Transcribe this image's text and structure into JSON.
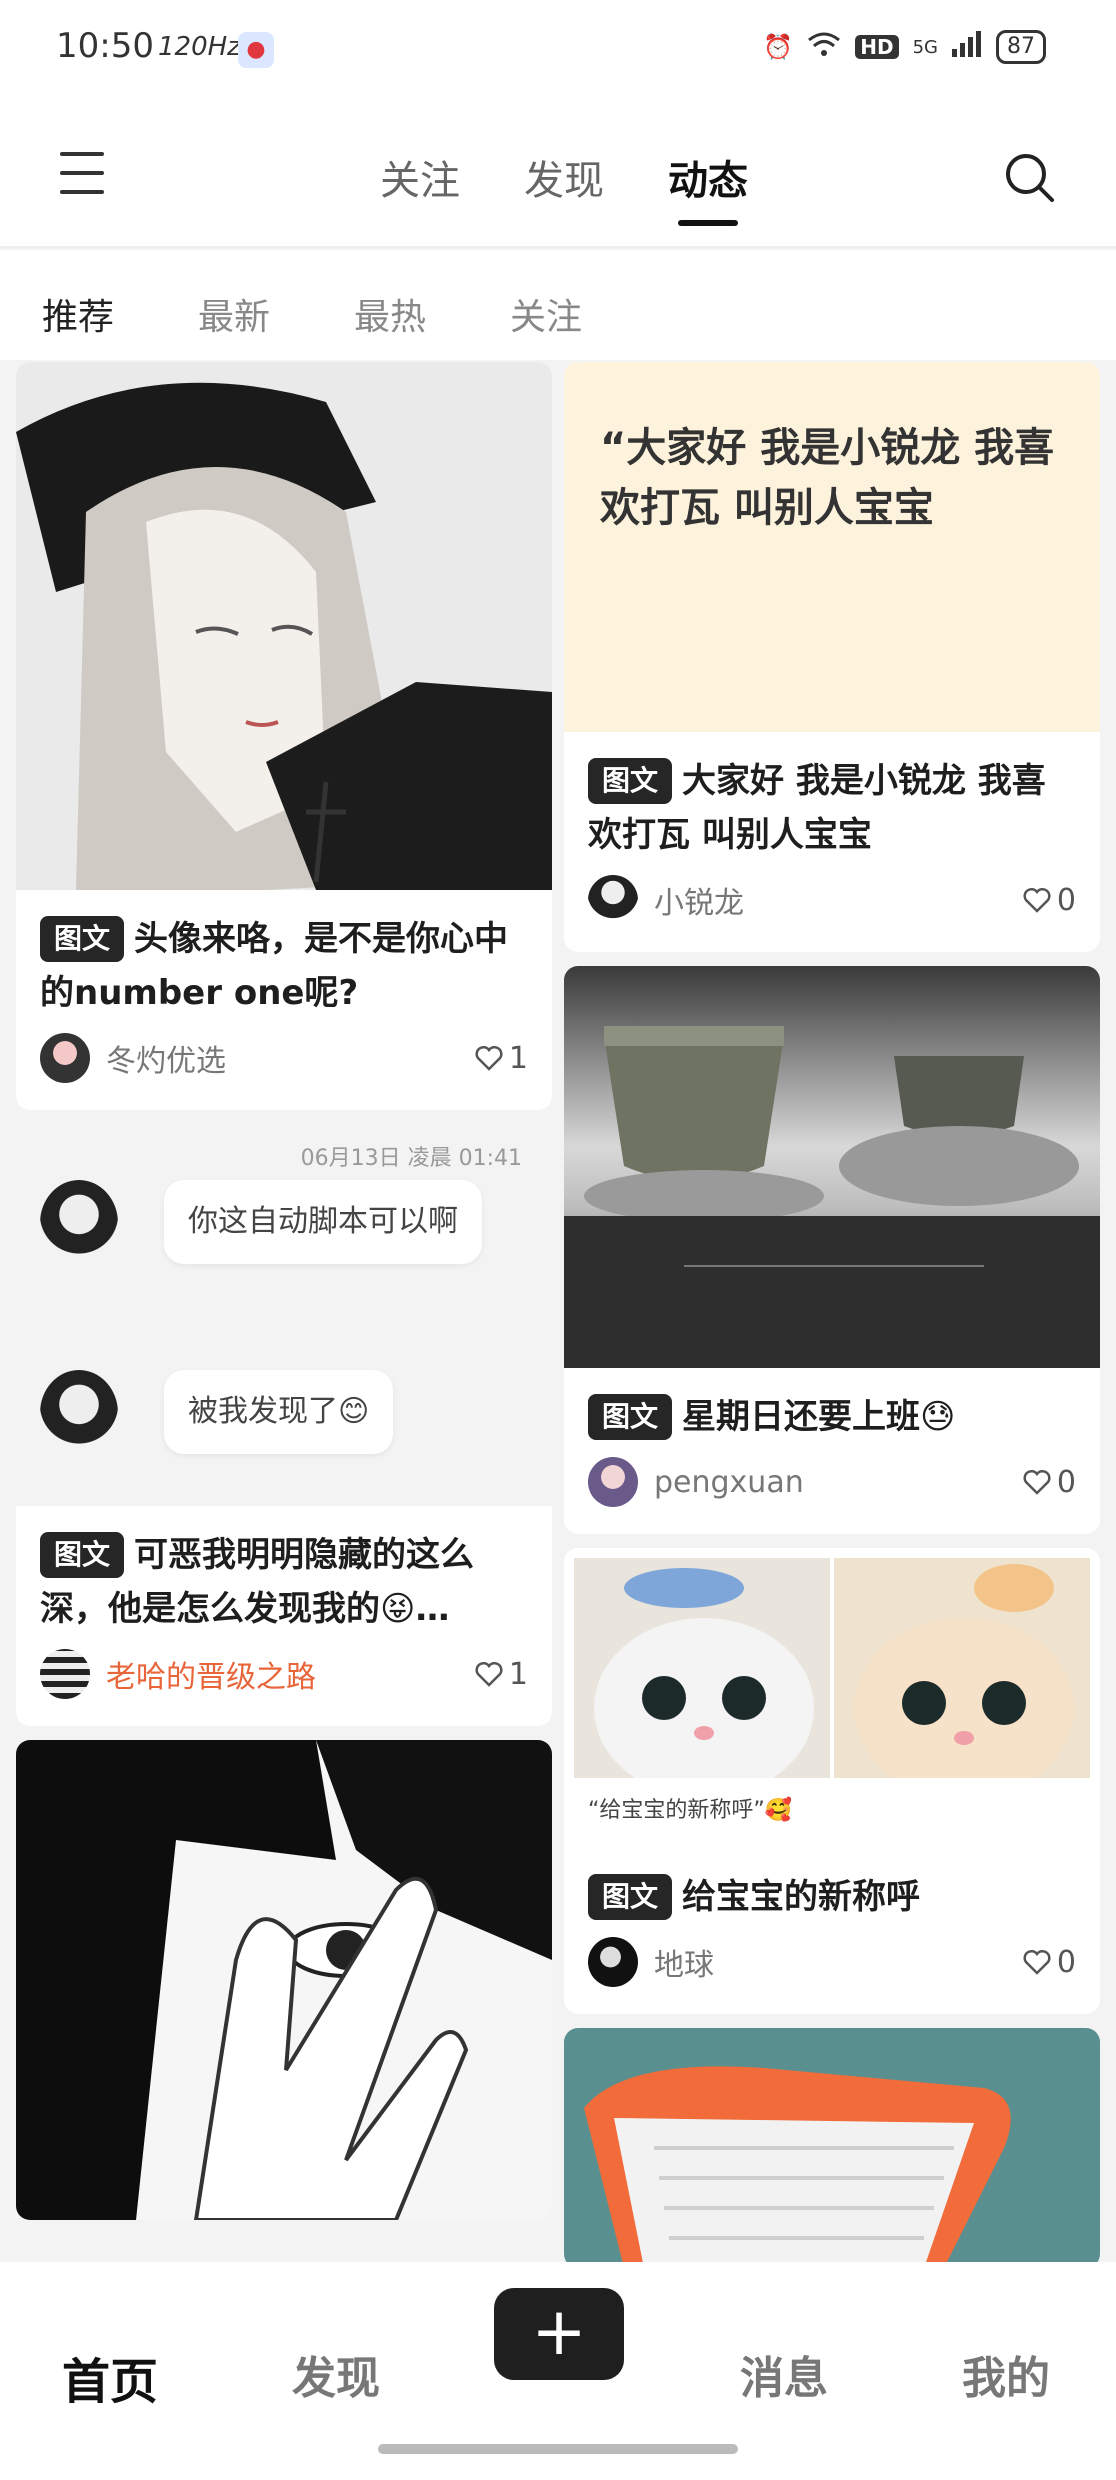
{
  "status": {
    "time": "10:50",
    "refresh": "120Hz",
    "hd": "HD",
    "network": "5G",
    "battery": "87"
  },
  "top_nav": {
    "tabs": [
      "关注",
      "发现",
      "动态"
    ],
    "active_index": 2
  },
  "sub_nav": {
    "tabs": [
      "推荐",
      "最新",
      "最热",
      "关注"
    ],
    "active_index": 0
  },
  "tag_label": "图文",
  "feed": {
    "left": [
      {
        "title": "头像来咯，是不是你心中的number one呢?",
        "author": "冬灼优选",
        "likes": "1"
      },
      {
        "chat": {
          "time": "06月13日 凌晨 01:41",
          "messages": [
            "你这自动脚本可以啊",
            "被我发现了😊"
          ]
        },
        "title": "可恶我明明隐藏的这么深，他是怎么发现我的😝…",
        "author": "老哈的晋级之路",
        "likes": "1"
      }
    ],
    "right": [
      {
        "cover_text": "“大家好 我是小锐龙 我喜欢打瓦 叫别人宝宝",
        "title": "大家好 我是小锐龙 我喜欢打瓦 叫别人宝宝",
        "author": "小锐龙",
        "likes": "0"
      },
      {
        "title": "星期日还要上班😓",
        "author": "pengxuan",
        "likes": "0"
      },
      {
        "cover_caption": "“给宝宝的新称呼”🥰",
        "title": "给宝宝的新称呼",
        "author": "地球",
        "likes": "0"
      }
    ]
  },
  "bottom_nav": {
    "home": "首页",
    "discover": "发现",
    "plus": "+",
    "messages": "消息",
    "me": "我的"
  }
}
